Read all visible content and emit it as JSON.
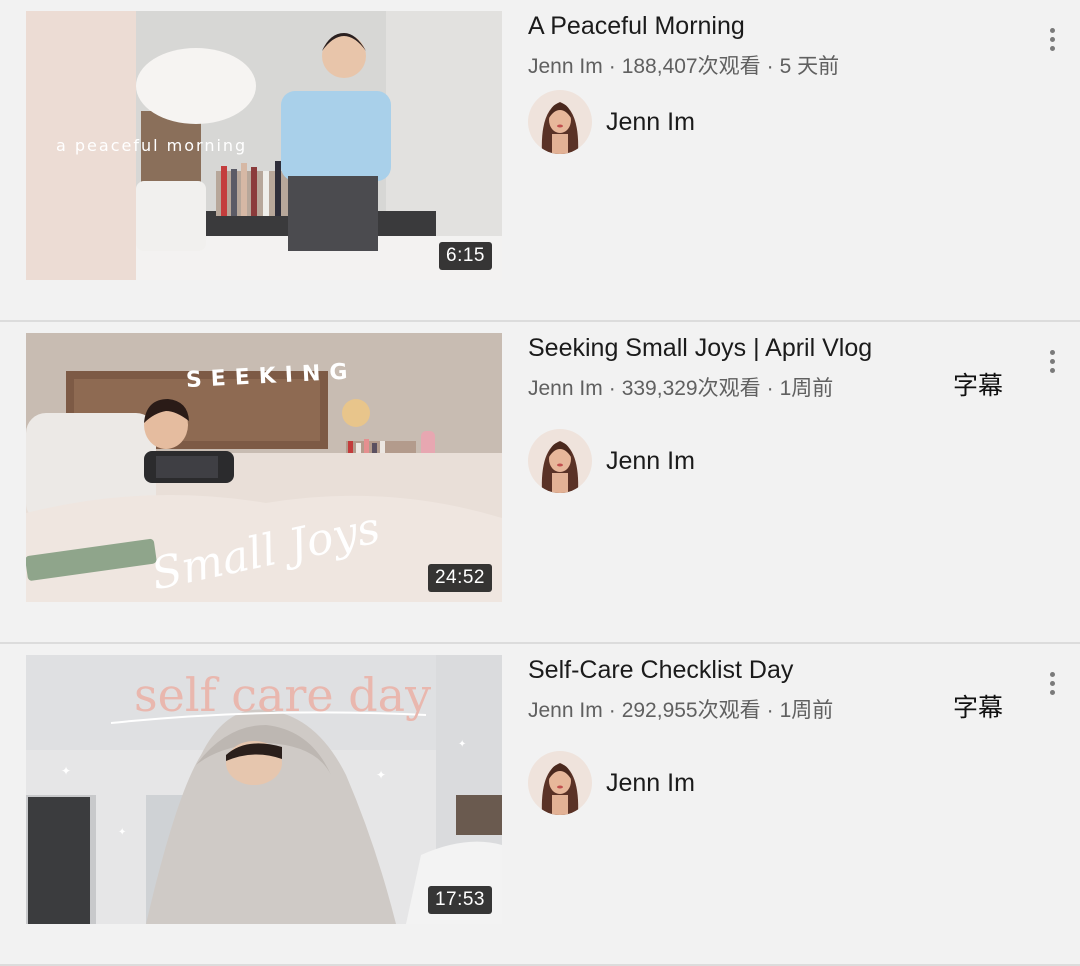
{
  "videos": [
    {
      "title": "A Peaceful Morning",
      "channel": "Jenn Im",
      "views": "188,407次观看",
      "age": "5 天前",
      "duration": "6:15",
      "badge": "",
      "thumb_text": "a peaceful morning"
    },
    {
      "title": "Seeking Small Joys | April Vlog",
      "channel": "Jenn Im",
      "views": "339,329次观看",
      "age": "1周前",
      "duration": "24:52",
      "badge": "字幕",
      "thumb_text_top": "SEEKING",
      "thumb_text_script": "Small Joys"
    },
    {
      "title": "Self-Care Checklist Day",
      "channel": "Jenn Im",
      "views": "292,955次观看",
      "age": "1周前",
      "duration": "17:53",
      "badge": "字幕",
      "thumb_text": "self care day"
    }
  ],
  "separator": "·",
  "icons": {
    "more": "more-vert-icon"
  }
}
